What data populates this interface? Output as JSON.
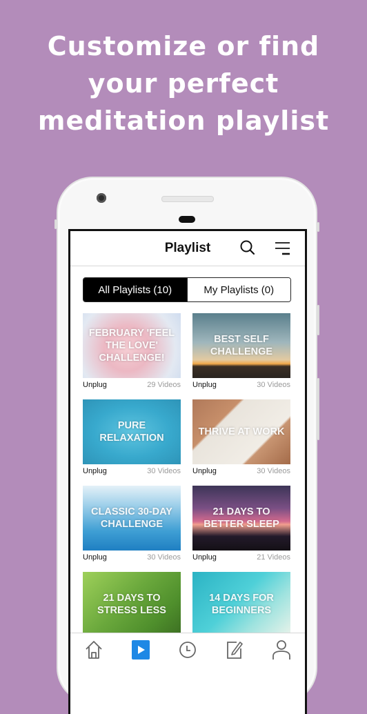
{
  "headline": {
    "lines": [
      "Customize or find",
      "your perfect",
      "meditation playlist"
    ]
  },
  "colors": {
    "background": "#b38cba",
    "nav_active": "#1e88e5",
    "segment_active_bg": "#000000"
  },
  "app": {
    "title": "Playlist",
    "icons": {
      "search": "search-icon",
      "menu": "menu-icon"
    },
    "tabs": [
      {
        "label": "All Playlists (10)",
        "active": true
      },
      {
        "label": "My Playlists (0)",
        "active": false
      }
    ],
    "playlists": [
      {
        "title": "February 'Feel the Love' Challenge!",
        "source": "Unplug",
        "count": "29 Videos"
      },
      {
        "title": "Best Self Challenge",
        "source": "Unplug",
        "count": "30 Videos"
      },
      {
        "title": "Pure Relaxation",
        "source": "Unplug",
        "count": "30 Videos"
      },
      {
        "title": "Thrive at Work",
        "source": "Unplug",
        "count": "30 Videos"
      },
      {
        "title": "Classic 30-Day Challenge",
        "source": "Unplug",
        "count": "30 Videos"
      },
      {
        "title": "21 Days to Better Sleep",
        "source": "Unplug",
        "count": "21 Videos"
      },
      {
        "title": "21 Days to Stress Less",
        "source": "",
        "count": ""
      },
      {
        "title": "14 Days for Beginners",
        "source": "",
        "count": ""
      }
    ],
    "bottom_nav": [
      {
        "icon": "home-icon",
        "active": false
      },
      {
        "icon": "play-icon",
        "active": true
      },
      {
        "icon": "clock-icon",
        "active": false
      },
      {
        "icon": "edit-icon",
        "active": false
      },
      {
        "icon": "profile-icon",
        "active": false
      }
    ]
  }
}
